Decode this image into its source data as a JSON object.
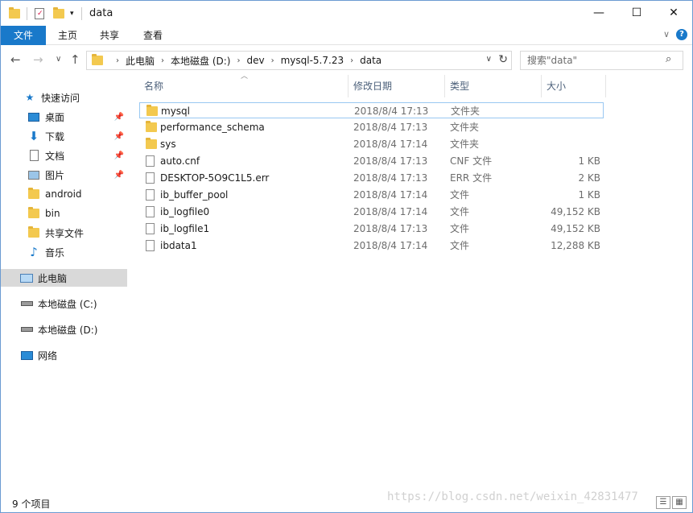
{
  "title": "data",
  "window_controls": {
    "minimize": "—",
    "maximize": "☐",
    "close": "✕"
  },
  "ribbon": {
    "tabs": [
      "文件",
      "主页",
      "共享",
      "查看"
    ],
    "expand_glyph": "∨",
    "help_glyph": "?"
  },
  "nav": {
    "back": "←",
    "forward": "→",
    "recent": "∨",
    "up": "↑"
  },
  "address": {
    "crumbs": [
      "此电脑",
      "本地磁盘 (D:)",
      "dev",
      "mysql-5.7.23",
      "data"
    ],
    "dropdown": "∨",
    "refresh": "↻"
  },
  "search": {
    "placeholder": "搜索\"data\"",
    "icon": "search-icon"
  },
  "sidebar": {
    "items": [
      {
        "label": "快速访问",
        "icon": "star-icon",
        "color": "#1979ca"
      },
      {
        "label": "桌面",
        "icon": "desktop-icon",
        "pinned": true
      },
      {
        "label": "下载",
        "icon": "download-icon",
        "pinned": true
      },
      {
        "label": "文档",
        "icon": "document-icon",
        "pinned": true
      },
      {
        "label": "图片",
        "icon": "pictures-icon",
        "pinned": true
      },
      {
        "label": "android",
        "icon": "folder-icon"
      },
      {
        "label": "bin",
        "icon": "folder-icon"
      },
      {
        "label": "共享文件",
        "icon": "folder-icon"
      },
      {
        "label": "音乐",
        "icon": "music-icon"
      },
      {
        "label": "此电脑",
        "icon": "computer-icon",
        "selected": true
      },
      {
        "label": "本地磁盘 (C:)",
        "icon": "drive-c-icon"
      },
      {
        "label": "本地磁盘 (D:)",
        "icon": "drive-d-icon"
      },
      {
        "label": "网络",
        "icon": "network-icon"
      }
    ]
  },
  "columns": {
    "name": "名称",
    "date": "修改日期",
    "type": "类型",
    "size": "大小"
  },
  "files": [
    {
      "name": "mysql",
      "date": "2018/8/4 17:13",
      "type": "文件夹",
      "size": "",
      "kind": "folder"
    },
    {
      "name": "performance_schema",
      "date": "2018/8/4 17:13",
      "type": "文件夹",
      "size": "",
      "kind": "folder"
    },
    {
      "name": "sys",
      "date": "2018/8/4 17:14",
      "type": "文件夹",
      "size": "",
      "kind": "folder"
    },
    {
      "name": "auto.cnf",
      "date": "2018/8/4 17:13",
      "type": "CNF 文件",
      "size": "1 KB",
      "kind": "file"
    },
    {
      "name": "DESKTOP-5O9C1L5.err",
      "date": "2018/8/4 17:13",
      "type": "ERR 文件",
      "size": "2 KB",
      "kind": "file"
    },
    {
      "name": "ib_buffer_pool",
      "date": "2018/8/4 17:14",
      "type": "文件",
      "size": "1 KB",
      "kind": "file"
    },
    {
      "name": "ib_logfile0",
      "date": "2018/8/4 17:14",
      "type": "文件",
      "size": "49,152 KB",
      "kind": "file"
    },
    {
      "name": "ib_logfile1",
      "date": "2018/8/4 17:13",
      "type": "文件",
      "size": "49,152 KB",
      "kind": "file"
    },
    {
      "name": "ibdata1",
      "date": "2018/8/4 17:14",
      "type": "文件",
      "size": "12,288 KB",
      "kind": "file"
    }
  ],
  "status": {
    "item_count": "9 个项目"
  },
  "watermark": "https://blog.csdn.net/weixin_42831477"
}
